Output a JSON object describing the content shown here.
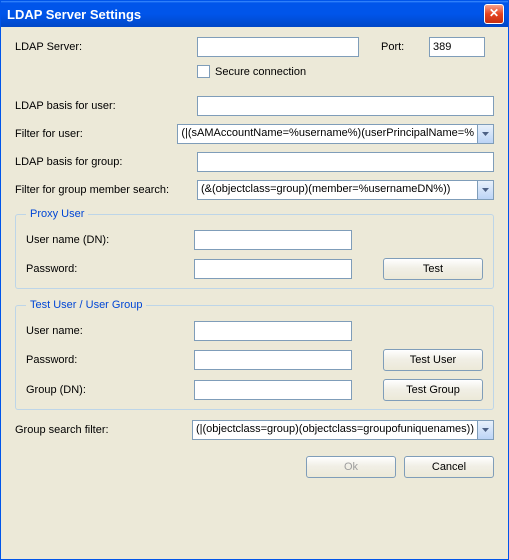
{
  "title": "LDAP Server Settings",
  "server": {
    "label": "LDAP Server:",
    "value": "",
    "port_label": "Port:",
    "port_value": "389",
    "secure_label": "Secure connection"
  },
  "user_basis": {
    "label": "LDAP basis for user:",
    "value": ""
  },
  "user_filter": {
    "label": "Filter for user:",
    "value": "(|(sAMAccountName=%username%)(userPrincipalName=%"
  },
  "group_basis": {
    "label": "LDAP basis for group:",
    "value": ""
  },
  "group_member_filter": {
    "label": "Filter for group member search:",
    "value": "(&(objectclass=group)(member=%usernameDN%))"
  },
  "proxy": {
    "legend": "Proxy User",
    "user_label": "User name (DN):",
    "user_value": "",
    "pass_label": "Password:",
    "pass_value": "",
    "test_button": "Test"
  },
  "test": {
    "legend": "Test User / User Group",
    "user_label": "User name:",
    "user_value": "",
    "pass_label": "Password:",
    "pass_value": "",
    "group_label": "Group (DN):",
    "group_value": "",
    "test_user_button": "Test User",
    "test_group_button": "Test Group"
  },
  "group_search": {
    "label": "Group search filter:",
    "value": "(|(objectclass=group)(objectclass=groupofuniquenames))"
  },
  "footer": {
    "ok": "Ok",
    "cancel": "Cancel"
  }
}
